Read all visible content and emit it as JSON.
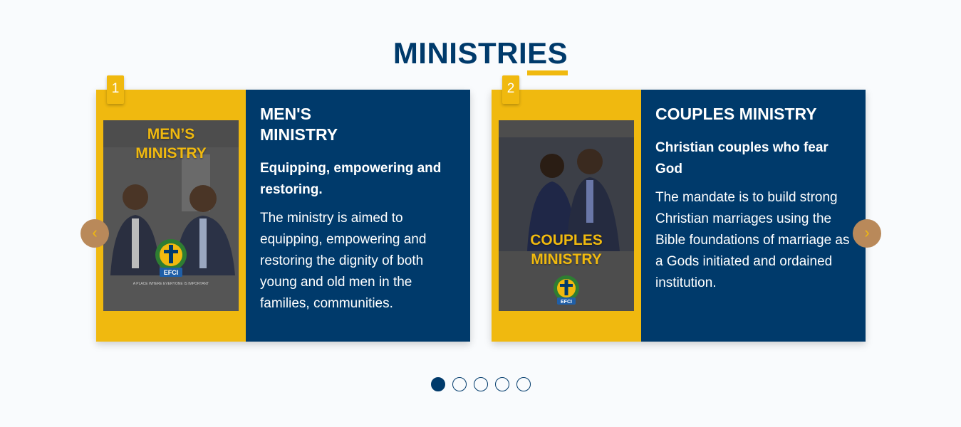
{
  "section": {
    "title": "MINISTRIES"
  },
  "colors": {
    "navy": "#003a6b",
    "gold": "#f0b90f",
    "nav_button": "#b9895a"
  },
  "cards": [
    {
      "index": "1",
      "poster_text_line1": "MEN’S",
      "poster_text_line2": "MINISTRY",
      "poster_tagline": "A PLACE WHERE EVERYONE IS IMPORTANT",
      "emblem_label": "EFCI",
      "title": "MEN'S MINISTRY",
      "subtitle": "Equipping, empowering and restoring.",
      "body": "The ministry is aimed to equipping, empowering and restoring the dignity of both young and old men in the families, communities."
    },
    {
      "index": "2",
      "poster_text_line1": "COUPLES",
      "poster_text_line2": "MINISTRY",
      "emblem_label": "EFCI",
      "title": "COUPLES MINISTRY",
      "subtitle": "Christian couples who fear God",
      "body": "The mandate is to build strong Christian marriages using the Bible foundations of marriage as a Gods initiated and ordained institution."
    }
  ],
  "navigation": {
    "prev_icon": "‹",
    "next_icon": "›"
  },
  "pagination": {
    "total": 5,
    "active": 1
  }
}
